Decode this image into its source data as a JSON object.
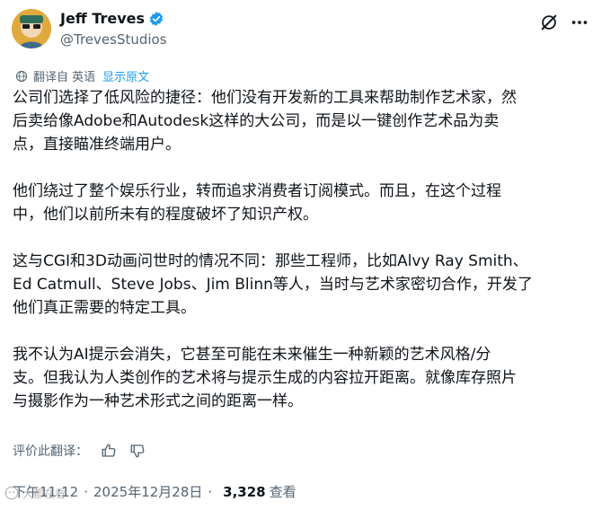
{
  "author": {
    "name": "Jeff Treves",
    "handle": "@TrevesStudios"
  },
  "translation": {
    "translated_from": "翻译自 英语",
    "show_original": "显示原文"
  },
  "tweet": {
    "paragraphs": [
      "公司们选择了低风险的捷径：他们没有开发新的工具来帮助制作艺术家，然\n后卖给像Adobe和Autodesk这样的大公司，而是以一键创作艺术品为卖\n点，直接瞄准终端用户。",
      "他们绕过了整个娱乐行业，转而追求消费者订阅模式。而且，在这个过程\n中，他们以前所未有的程度破坏了知识产权。",
      "这与CGI和3D动画问世时的情况不同：那些工程师，比如Alvy Ray Smith、\nEd Catmull、Steve Jobs、Jim Blinn等人，当时与艺术家密切合作，开发了\n他们真正需要的特定工具。",
      "我不认为AI提示会消失，它甚至可能在未来催生一种新颖的艺术风格/分\n支。但我认为人类创作的艺术将与提示生成的内容拉开距离。就像库存照片\n与摄影作为一种艺术形式之间的距离一样。"
    ]
  },
  "rate_translation": {
    "label": "评价此翻译："
  },
  "meta": {
    "time": "下午11:12",
    "separator": "·",
    "date": "2025年12月28日",
    "views_count": "3,328",
    "views_label": "查看"
  },
  "watermark": {
    "text": "大都在看"
  },
  "colors": {
    "accent": "#1d9bf0",
    "text_primary": "#0f1419",
    "text_secondary": "#536471"
  },
  "icons": {
    "verified": "verified-badge-icon",
    "grok": "grok-icon",
    "more": "more-icon",
    "translate": "globe-icon",
    "thumb_up": "thumb-up-icon",
    "thumb_down": "thumb-down-icon"
  }
}
